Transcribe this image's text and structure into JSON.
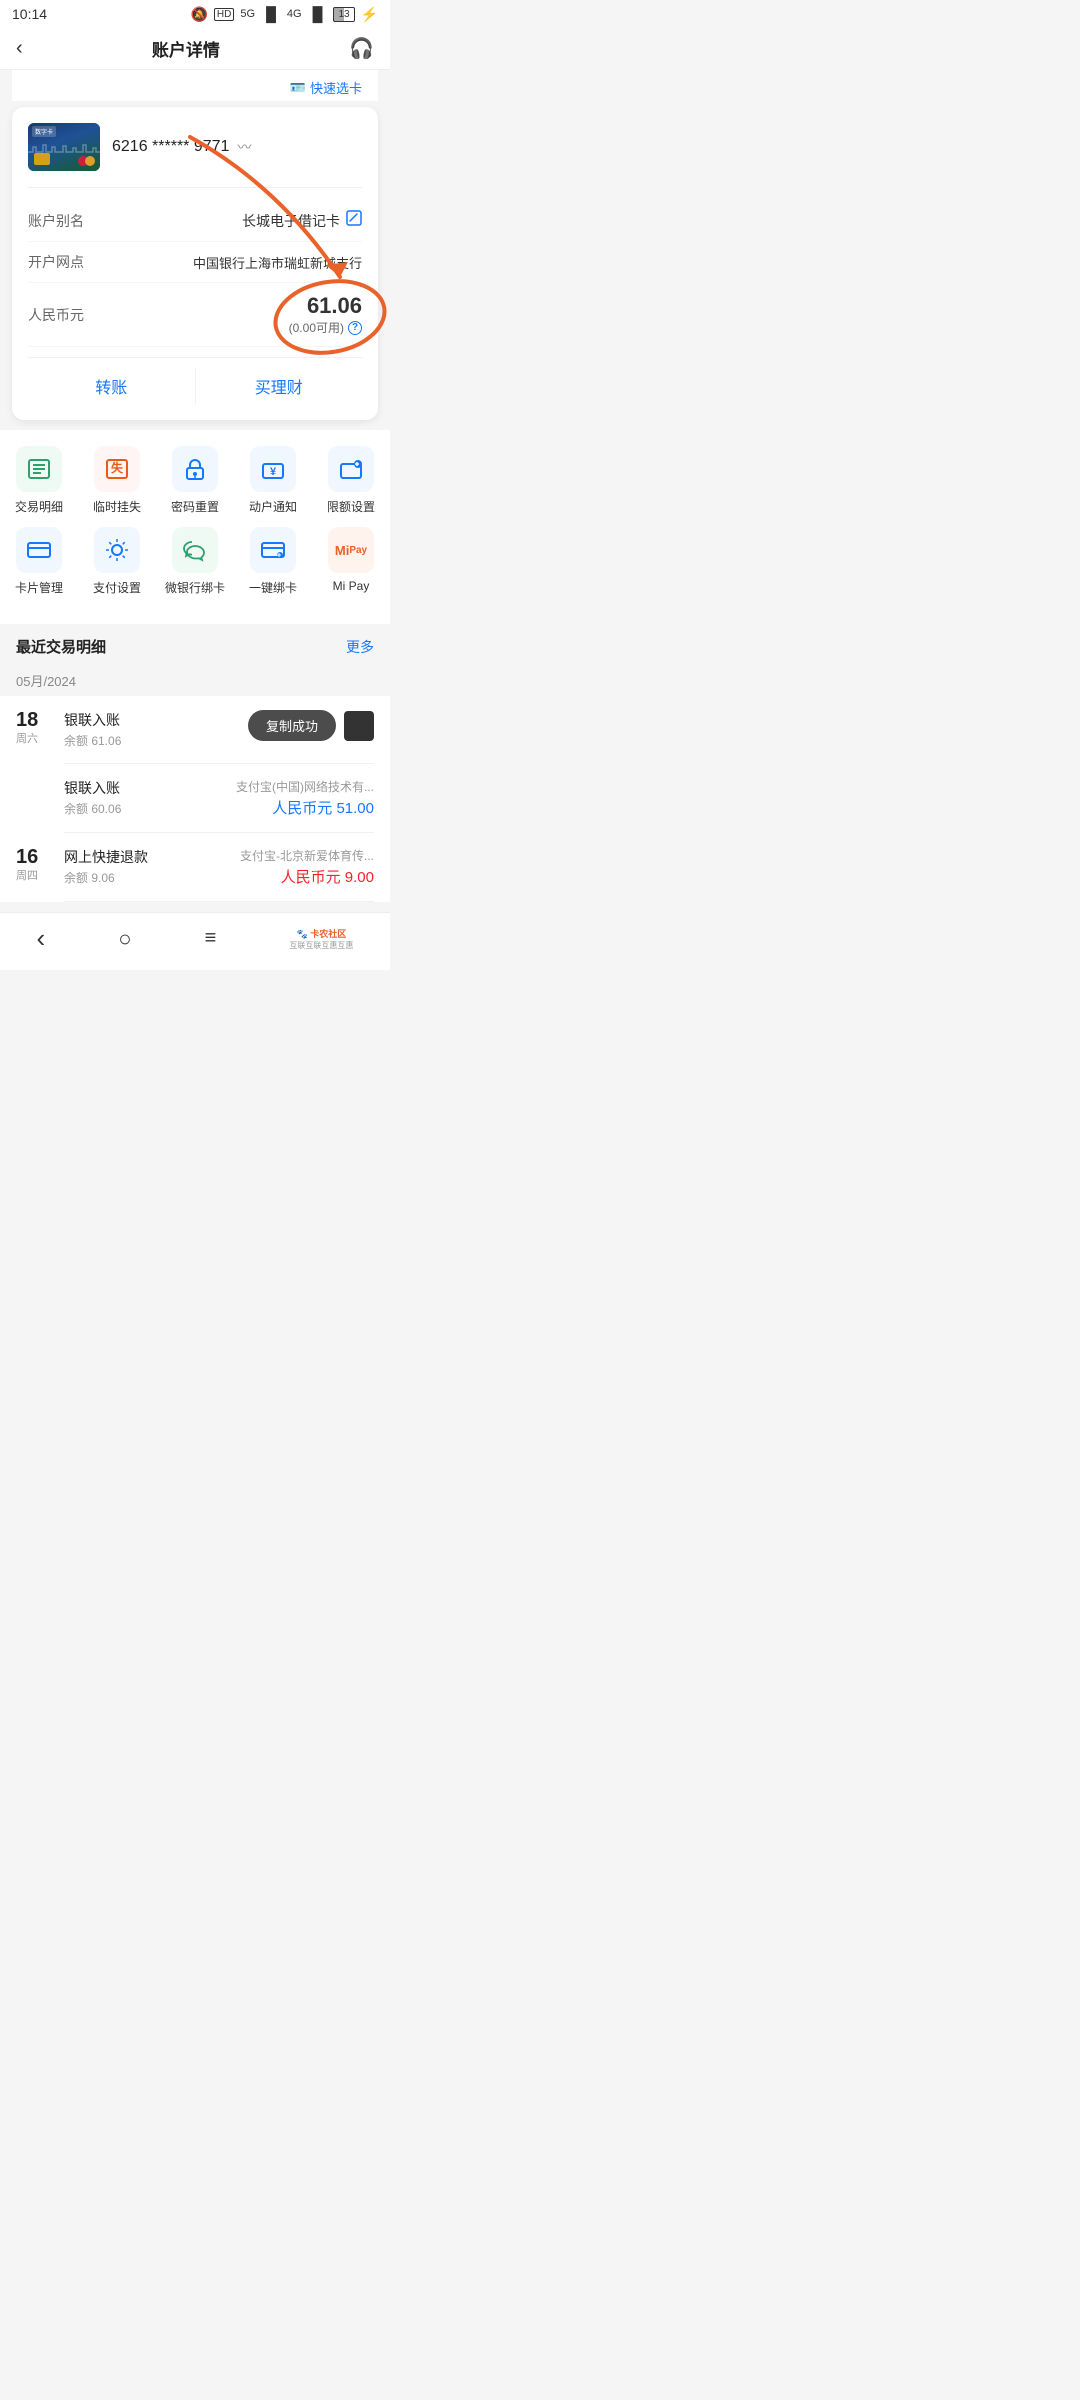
{
  "statusBar": {
    "time": "10:14",
    "notification": "📧",
    "dots": "···",
    "hd": "HD",
    "network5g": "5G",
    "network4g": "4G",
    "battery": "13"
  },
  "nav": {
    "backIcon": "‹",
    "title": "账户详情",
    "headphoneIcon": "🎧"
  },
  "quickSelect": {
    "icon": "🪪",
    "label": "快速选卡"
  },
  "card": {
    "digitalLabel": "数字卡",
    "number": "6216 ****** 9771",
    "eyeIcon": "﹏"
  },
  "accountInfo": {
    "aliasLabel": "账户别名",
    "aliasValue": "长城电子借记卡",
    "editIcon": "✏",
    "branchLabel": "开户网点",
    "branchValue": "中国银行上海市瑞虹新城支行",
    "currencyLabel": "人民币元",
    "balance": "61.06",
    "availableBalance": "(0.00可用)",
    "helpIcon": "?"
  },
  "actionButtons": {
    "transfer": "转账",
    "invest": "买理财"
  },
  "menuItems": {
    "row1": [
      {
        "id": "tx-detail",
        "icon": "≡",
        "label": "交易明细",
        "color": "green"
      },
      {
        "id": "suspend",
        "icon": "✗",
        "label": "临时挂失",
        "color": "red"
      },
      {
        "id": "password",
        "icon": "🔐",
        "label": "密码重置",
        "color": "blue"
      },
      {
        "id": "notify",
        "icon": "¥",
        "label": "动户通知",
        "color": "blue"
      },
      {
        "id": "limit",
        "icon": "⚙",
        "label": "限额设置",
        "color": "blue"
      }
    ],
    "row2": [
      {
        "id": "card-mgmt",
        "icon": "🗃",
        "label": "卡片管理",
        "color": "blue"
      },
      {
        "id": "payment-set",
        "icon": "⚙",
        "label": "支付设置",
        "color": "blue"
      },
      {
        "id": "wechat-bind",
        "icon": "💬",
        "label": "微银行绑卡",
        "color": "green"
      },
      {
        "id": "onekey-bind",
        "icon": "🔗",
        "label": "一键绑卡",
        "color": "blue"
      },
      {
        "id": "mipay",
        "icon": "Mi",
        "label": "Mi Pay",
        "color": "orange"
      }
    ]
  },
  "recentTx": {
    "sectionTitle": "最近交易明细",
    "moreLabel": "更多",
    "monthLabel": "05月/2024",
    "transactions": [
      {
        "day": "18",
        "weekday": "周六",
        "entries": [
          {
            "title": "银联入账",
            "balance": "余额 61.06",
            "source": "",
            "amount": "",
            "amountType": "income",
            "hasCopyToast": true
          }
        ]
      },
      {
        "day": "",
        "weekday": "",
        "entries": [
          {
            "title": "银联入账",
            "balance": "余额 60.06",
            "source": "支付宝(中国)网络技术有...",
            "amount": "人民币元 51.00",
            "amountType": "income"
          }
        ]
      },
      {
        "day": "16",
        "weekday": "周四",
        "entries": [
          {
            "title": "网上快捷退款",
            "balance": "余额 9.06",
            "source": "支付宝-北京新爱体育传...",
            "amount": "人民币元 9.00",
            "amountType": "expense"
          }
        ]
      }
    ]
  },
  "toast": {
    "message": "复制成功"
  },
  "bottomNav": {
    "back": "‹",
    "home": "○",
    "menu": "≡"
  },
  "watermark": "卡农社区"
}
